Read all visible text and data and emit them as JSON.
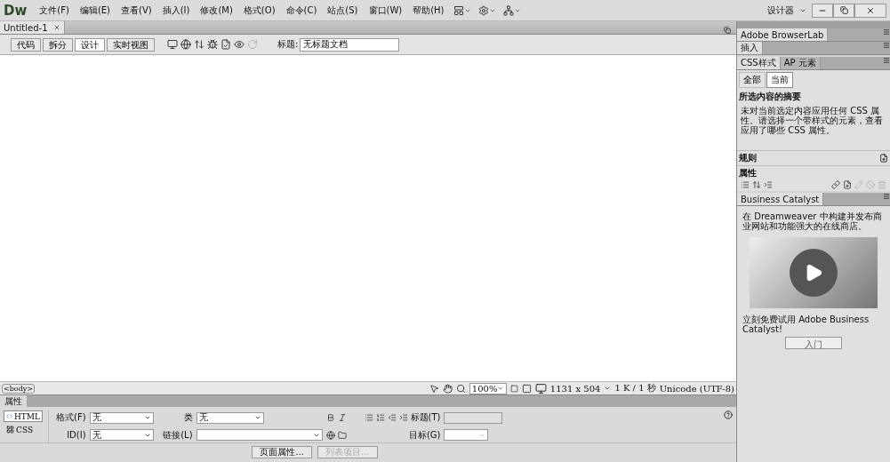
{
  "app": {
    "logo": "Dw",
    "menu": [
      "文件(F)",
      "编辑(E)",
      "查看(V)",
      "插入(I)",
      "修改(M)",
      "格式(O)",
      "命令(C)",
      "站点(S)",
      "窗口(W)",
      "帮助(H)"
    ],
    "workspace": "设计器"
  },
  "document_tabs": [
    {
      "label": "Untitled-1",
      "selected": true
    }
  ],
  "view_buttons": [
    {
      "label": "代码",
      "selected": false
    },
    {
      "label": "拆分",
      "selected": false
    },
    {
      "label": "设计",
      "selected": true
    },
    {
      "label": "实时视图",
      "selected": false
    }
  ],
  "title_field": {
    "label": "标题:",
    "value": "无标题文档"
  },
  "status_bar": {
    "tag": "<body>",
    "zoom": "100%",
    "size": "1131 x 504",
    "weight": "1 K / 1 秒",
    "encoding": "Unicode (UTF-8)"
  },
  "properties": {
    "tab": "属性",
    "modes": [
      {
        "label": "HTML",
        "selected": true
      },
      {
        "label": "CSS",
        "selected": false
      }
    ],
    "format_label": "格式(F)",
    "format_value": "无",
    "id_label": "ID(I)",
    "id_value": "无",
    "class_label": "类",
    "class_value": "无",
    "link_label": "链接(L)",
    "title_label": "标题(T)",
    "target_label": "目标(G)",
    "buttons": [
      {
        "label": "页面属性...",
        "disabled": false
      },
      {
        "label": "列表项目...",
        "disabled": true
      }
    ]
  },
  "panels": {
    "browserlab": "Adobe BrowserLab",
    "insert": "插入",
    "css_tabs": [
      {
        "label": "CSS样式",
        "selected": true
      },
      {
        "label": "AP 元素",
        "selected": false
      }
    ],
    "css_modes": [
      {
        "label": "全部",
        "selected": false
      },
      {
        "label": "当前",
        "selected": true
      }
    ],
    "summary_heading": "所选内容的摘要",
    "summary_text": "未对当前选定内容应用任何 CSS 属性。请选择一个带样式的元素，查看应用了哪些 CSS 属性。",
    "rules_heading": "规则",
    "props_heading": "属性",
    "bc_title": "Business Catalyst",
    "bc_text": "在 Dreamweaver 中构建并发布商业网站和功能强大的在线商店。",
    "bc_promo": "立刻免费试用 Adobe Business Catalyst!",
    "bc_button": "入门"
  }
}
